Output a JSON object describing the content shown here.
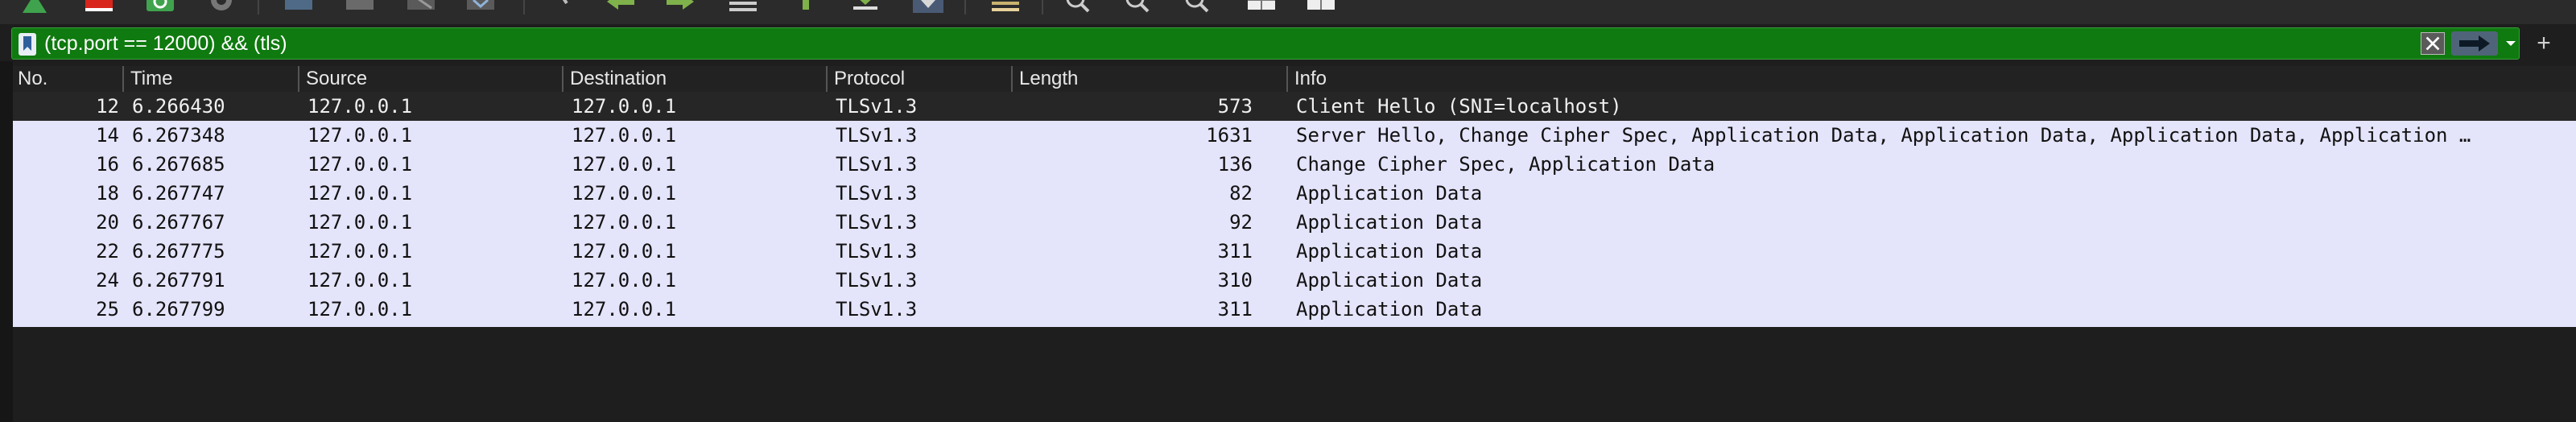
{
  "toolbar": {
    "icons": [
      "start-capture-icon",
      "stop-capture-icon",
      "restart-capture-icon",
      "capture-options-icon",
      "open-file-icon",
      "save-file-icon",
      "close-file-icon",
      "reload-file-icon",
      "find-packet-icon",
      "go-back-icon",
      "go-forward-icon",
      "go-to-packet-icon",
      "go-first-icon",
      "go-last-icon",
      "autoscroll-icon",
      "colorize-icon",
      "zoom-in-icon",
      "zoom-out-icon",
      "zoom-normal-icon",
      "resize-columns-icon",
      "columns-icon"
    ]
  },
  "filter": {
    "value": "(tcp.port == 12000) && (tls)",
    "accent": "#0f7a0f",
    "add_label": "+"
  },
  "columns": [
    "No.",
    "Time",
    "Source",
    "Destination",
    "Protocol",
    "Length",
    "Info"
  ],
  "packets": [
    {
      "no": "12",
      "time": "6.266430",
      "source": "127.0.0.1",
      "destination": "127.0.0.1",
      "protocol": "TLSv1.3",
      "length": "573",
      "info": "Client Hello (SNI=localhost)"
    },
    {
      "no": "14",
      "time": "6.267348",
      "source": "127.0.0.1",
      "destination": "127.0.0.1",
      "protocol": "TLSv1.3",
      "length": "1631",
      "info": "Server Hello, Change Cipher Spec, Application Data, Application Data, Application Data, Application …"
    },
    {
      "no": "16",
      "time": "6.267685",
      "source": "127.0.0.1",
      "destination": "127.0.0.1",
      "protocol": "TLSv1.3",
      "length": "136",
      "info": "Change Cipher Spec, Application Data"
    },
    {
      "no": "18",
      "time": "6.267747",
      "source": "127.0.0.1",
      "destination": "127.0.0.1",
      "protocol": "TLSv1.3",
      "length": "82",
      "info": "Application Data"
    },
    {
      "no": "20",
      "time": "6.267767",
      "source": "127.0.0.1",
      "destination": "127.0.0.1",
      "protocol": "TLSv1.3",
      "length": "92",
      "info": "Application Data"
    },
    {
      "no": "22",
      "time": "6.267775",
      "source": "127.0.0.1",
      "destination": "127.0.0.1",
      "protocol": "TLSv1.3",
      "length": "311",
      "info": "Application Data"
    },
    {
      "no": "24",
      "time": "6.267791",
      "source": "127.0.0.1",
      "destination": "127.0.0.1",
      "protocol": "TLSv1.3",
      "length": "310",
      "info": "Application Data"
    },
    {
      "no": "25",
      "time": "6.267799",
      "source": "127.0.0.1",
      "destination": "127.0.0.1",
      "protocol": "TLSv1.3",
      "length": "311",
      "info": "Application Data"
    }
  ],
  "colors": {
    "row_bg": "#e4e4fb",
    "selected_bg": "#262626",
    "header_bg": "#222222"
  }
}
